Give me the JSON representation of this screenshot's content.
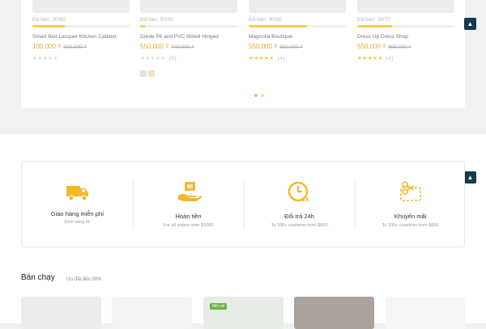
{
  "carousel": {
    "products": [
      {
        "sold": "Đã bán: 20/60",
        "sold_fraction": 0.33,
        "name": "Smart Bed Lacquer Kitchen Cabinet",
        "price": "100.000 ₫",
        "old_price": "300.000 ₫",
        "stars": 0,
        "count": ""
      },
      {
        "sold": "Đã bán: 5/100",
        "sold_fraction": 0.05,
        "name": "Drede P6 and PVC Mixed Hinged",
        "price": "550.000 ₫",
        "old_price": "700.000 ₫",
        "stars": 0,
        "count": "(0)"
      },
      {
        "sold": "Đã bán: 30/50",
        "sold_fraction": 0.6,
        "name": "Magnolia Boutique",
        "price": "550.000 ₫",
        "old_price": "650.000 ₫",
        "stars": 5,
        "count": "(4)"
      },
      {
        "sold": "Đã bán: 28/77",
        "sold_fraction": 0.36,
        "name": "Dress Up Dress Shop",
        "price": "550.000 ₫",
        "old_price": "900.000 ₫",
        "stars": 5,
        "count": "(4)"
      }
    ],
    "swatch_colors": [
      "#dfe8f0",
      "#f5e7a6"
    ],
    "dots": 2,
    "active_dot": 0
  },
  "scroll_top_icon": "chevron-up-icon",
  "features": [
    {
      "icon": "delivery-truck-icon",
      "title": "Giao hàng miễn phí",
      "subtitle": "Đơn hàng từ"
    },
    {
      "icon": "money-hand-icon",
      "title": "Hoàn tiền",
      "subtitle": "For all orders over $1000"
    },
    {
      "icon": "clock-24h-icon",
      "title": "Đổi trả 24h",
      "subtitle": "To 100+ countries from $600"
    },
    {
      "icon": "scissors-coupon-icon",
      "title": "Khuyến mãi",
      "subtitle": "To 100+ countries from $600"
    }
  ],
  "best_sellers": {
    "title": "Bán chạy",
    "subtitle": "Ưu đãi đến 50%",
    "badge": "Mới về",
    "cards": [
      "#ececec",
      "#f3f3f3",
      "#e8ece6",
      "#a9a39c",
      "#f6f6f6"
    ]
  },
  "colors": {
    "accent": "#f3c53a",
    "price": "#f0a92c",
    "scroll_button": "#123a50",
    "badge": "#6cb33f"
  }
}
